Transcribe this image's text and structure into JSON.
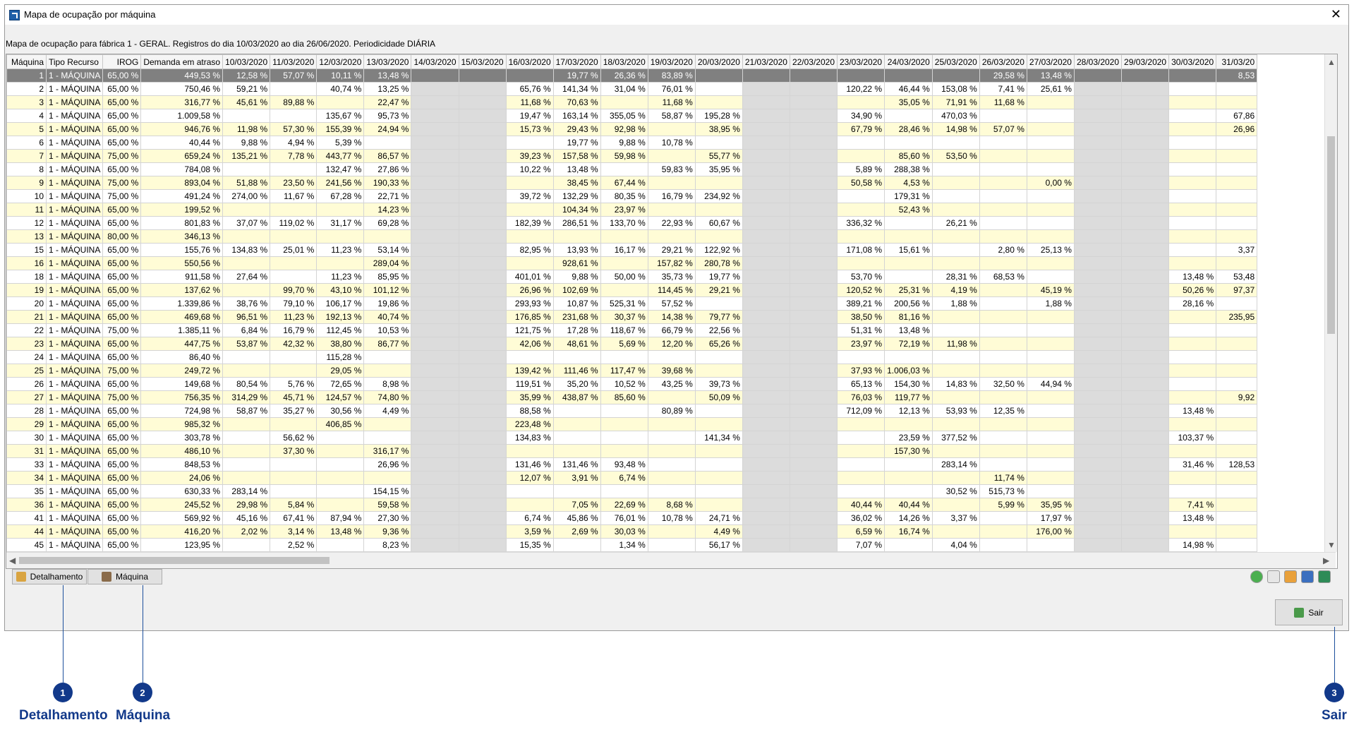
{
  "window": {
    "title": "Mapa de ocupação por máquina",
    "close": "✕"
  },
  "subtitle": "Mapa de ocupação para fábrica 1 - GERAL. Registros do dia 10/03/2020 ao dia 26/06/2020. Periodicidade DIÁRIA",
  "grid": {
    "columns": [
      "Máquina",
      "Tipo Recurso",
      "IROG",
      "Demanda em atraso",
      "10/03/2020",
      "11/03/2020",
      "12/03/2020",
      "13/03/2020",
      "14/03/2020",
      "15/03/2020",
      "16/03/2020",
      "17/03/2020",
      "18/03/2020",
      "19/03/2020",
      "20/03/2020",
      "21/03/2020",
      "22/03/2020",
      "23/03/2020",
      "24/03/2020",
      "25/03/2020",
      "26/03/2020",
      "27/03/2020",
      "28/03/2020",
      "29/03/2020",
      "30/03/2020",
      "31/03/20"
    ],
    "rows": [
      [
        "1",
        "1 - MÁQUINA",
        "65,00 %",
        "449,53 %",
        "12,58 %",
        "57,07 %",
        "10,11 %",
        "13,48 %",
        "",
        "",
        "",
        "19,77 %",
        "26,36 %",
        "83,89 %",
        "",
        "",
        "",
        "",
        "",
        "",
        "29,58 %",
        "13,48 %",
        "",
        "",
        "",
        "8,53"
      ],
      [
        "2",
        "1 - MÁQUINA",
        "65,00 %",
        "750,46 %",
        "59,21 %",
        "",
        "40,74 %",
        "13,25 %",
        "",
        "",
        "65,76 %",
        "141,34 %",
        "31,04 %",
        "76,01 %",
        "",
        "",
        "",
        "120,22 %",
        "46,44 %",
        "153,08 %",
        "7,41 %",
        "25,61 %",
        "",
        "",
        "",
        ""
      ],
      [
        "3",
        "1 - MÁQUINA",
        "65,00 %",
        "316,77 %",
        "45,61 %",
        "89,88 %",
        "",
        "22,47 %",
        "",
        "",
        "11,68 %",
        "70,63 %",
        "",
        "11,68 %",
        "",
        "",
        "",
        "",
        "35,05 %",
        "71,91 %",
        "11,68 %",
        "",
        "",
        "",
        "",
        ""
      ],
      [
        "4",
        "1 - MÁQUINA",
        "65,00 %",
        "1.009,58 %",
        "",
        "",
        "135,67 %",
        "95,73 %",
        "",
        "",
        "19,47 %",
        "163,14 %",
        "355,05 %",
        "58,87 %",
        "195,28 %",
        "",
        "",
        "34,90 %",
        "",
        "470,03 %",
        "",
        "",
        "",
        "",
        "",
        "67,86"
      ],
      [
        "5",
        "1 - MÁQUINA",
        "65,00 %",
        "946,76 %",
        "11,98 %",
        "57,30 %",
        "155,39 %",
        "24,94 %",
        "",
        "",
        "15,73 %",
        "29,43 %",
        "92,98 %",
        "",
        "38,95 %",
        "",
        "",
        "67,79 %",
        "28,46 %",
        "14,98 %",
        "57,07 %",
        "",
        "",
        "",
        "",
        "26,96"
      ],
      [
        "6",
        "1 - MÁQUINA",
        "65,00 %",
        "40,44 %",
        "9,88 %",
        "4,94 %",
        "5,39 %",
        "",
        "",
        "",
        "",
        "19,77 %",
        "9,88 %",
        "10,78 %",
        "",
        "",
        "",
        "",
        "",
        "",
        "",
        "",
        "",
        "",
        "",
        ""
      ],
      [
        "7",
        "1 - MÁQUINA",
        "75,00 %",
        "659,24 %",
        "135,21 %",
        "7,78 %",
        "443,77 %",
        "86,57 %",
        "",
        "",
        "39,23 %",
        "157,58 %",
        "59,98 %",
        "",
        "55,77 %",
        "",
        "",
        "",
        "85,60 %",
        "53,50 %",
        "",
        "",
        "",
        "",
        "",
        ""
      ],
      [
        "8",
        "1 - MÁQUINA",
        "65,00 %",
        "784,08 %",
        "",
        "",
        "132,47 %",
        "27,86 %",
        "",
        "",
        "10,22 %",
        "13,48 %",
        "",
        "59,83 %",
        "35,95 %",
        "",
        "",
        "5,89 %",
        "288,38 %",
        "",
        "",
        "",
        "",
        "",
        "",
        ""
      ],
      [
        "9",
        "1 - MÁQUINA",
        "75,00 %",
        "893,04 %",
        "51,88 %",
        "23,50 %",
        "241,56 %",
        "190,33 %",
        "",
        "",
        "",
        "38,45 %",
        "67,44 %",
        "",
        "",
        "",
        "",
        "50,58 %",
        "4,53 %",
        "",
        "",
        "0,00 %",
        "",
        "",
        "",
        ""
      ],
      [
        "10",
        "1 - MÁQUINA",
        "75,00 %",
        "491,24 %",
        "274,00 %",
        "11,67 %",
        "67,28 %",
        "22,71 %",
        "",
        "",
        "39,72 %",
        "132,29 %",
        "80,35 %",
        "16,79 %",
        "234,92 %",
        "",
        "",
        "",
        "179,31 %",
        "",
        "",
        "",
        "",
        "",
        "",
        ""
      ],
      [
        "11",
        "1 - MÁQUINA",
        "65,00 %",
        "199,52 %",
        "",
        "",
        "",
        "14,23 %",
        "",
        "",
        "",
        "104,34 %",
        "23,97 %",
        "",
        "",
        "",
        "",
        "",
        "52,43 %",
        "",
        "",
        "",
        "",
        "",
        "",
        ""
      ],
      [
        "12",
        "1 - MÁQUINA",
        "65,00 %",
        "801,83 %",
        "37,07 %",
        "119,02 %",
        "31,17 %",
        "69,28 %",
        "",
        "",
        "182,39 %",
        "286,51 %",
        "133,70 %",
        "22,93 %",
        "60,67 %",
        "",
        "",
        "336,32 %",
        "",
        "26,21 %",
        "",
        "",
        "",
        "",
        "",
        ""
      ],
      [
        "13",
        "1 - MÁQUINA",
        "80,00 %",
        "346,13 %",
        "",
        "",
        "",
        "",
        "",
        "",
        "",
        "",
        "",
        "",
        "",
        "",
        "",
        "",
        "",
        "",
        "",
        "",
        "",
        "",
        "",
        ""
      ],
      [
        "15",
        "1 - MÁQUINA",
        "65,00 %",
        "155,76 %",
        "134,83 %",
        "25,01 %",
        "11,23 %",
        "53,14 %",
        "",
        "",
        "82,95 %",
        "13,93 %",
        "16,17 %",
        "29,21 %",
        "122,92 %",
        "",
        "",
        "171,08 %",
        "15,61 %",
        "",
        "2,80 %",
        "25,13 %",
        "",
        "",
        "",
        "3,37"
      ],
      [
        "16",
        "1 - MÁQUINA",
        "65,00 %",
        "550,56 %",
        "",
        "",
        "",
        "289,04 %",
        "",
        "",
        "",
        "928,61 %",
        "",
        "157,82 %",
        "280,78 %",
        "",
        "",
        "",
        "",
        "",
        "",
        "",
        "",
        "",
        "",
        ""
      ],
      [
        "18",
        "1 - MÁQUINA",
        "65,00 %",
        "911,58 %",
        "27,64 %",
        "",
        "11,23 %",
        "85,95 %",
        "",
        "",
        "401,01 %",
        "9,88 %",
        "50,00 %",
        "35,73 %",
        "19,77 %",
        "",
        "",
        "53,70 %",
        "",
        "28,31 %",
        "68,53 %",
        "",
        "",
        "",
        "13,48 %",
        "53,48"
      ],
      [
        "19",
        "1 - MÁQUINA",
        "65,00 %",
        "137,62 %",
        "",
        "99,70 %",
        "43,10 %",
        "101,12 %",
        "",
        "",
        "26,96 %",
        "102,69 %",
        "",
        "114,45 %",
        "29,21 %",
        "",
        "",
        "120,52 %",
        "25,31 %",
        "4,19 %",
        "",
        "45,19 %",
        "",
        "",
        "50,26 %",
        "97,37"
      ],
      [
        "20",
        "1 - MÁQUINA",
        "65,00 %",
        "1.339,86 %",
        "38,76 %",
        "79,10 %",
        "106,17 %",
        "19,86 %",
        "",
        "",
        "293,93 %",
        "10,87 %",
        "525,31 %",
        "57,52 %",
        "",
        "",
        "",
        "389,21 %",
        "200,56 %",
        "1,88 %",
        "",
        "1,88 %",
        "",
        "",
        "28,16 %",
        ""
      ],
      [
        "21",
        "1 - MÁQUINA",
        "65,00 %",
        "469,68 %",
        "96,51 %",
        "11,23 %",
        "192,13 %",
        "40,74 %",
        "",
        "",
        "176,85 %",
        "231,68 %",
        "30,37 %",
        "14,38 %",
        "79,77 %",
        "",
        "",
        "38,50 %",
        "81,16 %",
        "",
        "",
        "",
        "",
        "",
        "",
        "235,95"
      ],
      [
        "22",
        "1 - MÁQUINA",
        "75,00 %",
        "1.385,11 %",
        "6,84 %",
        "16,79 %",
        "112,45 %",
        "10,53 %",
        "",
        "",
        "121,75 %",
        "17,28 %",
        "118,67 %",
        "66,79 %",
        "22,56 %",
        "",
        "",
        "51,31 %",
        "13,48 %",
        "",
        "",
        "",
        "",
        "",
        "",
        ""
      ],
      [
        "23",
        "1 - MÁQUINA",
        "65,00 %",
        "447,75 %",
        "53,87 %",
        "42,32 %",
        "38,80 %",
        "86,77 %",
        "",
        "",
        "42,06 %",
        "48,61 %",
        "5,69 %",
        "12,20 %",
        "65,26 %",
        "",
        "",
        "23,97 %",
        "72,19 %",
        "11,98 %",
        "",
        "",
        "",
        "",
        "",
        ""
      ],
      [
        "24",
        "1 - MÁQUINA",
        "65,00 %",
        "86,40 %",
        "",
        "",
        "115,28 %",
        "",
        "",
        "",
        "",
        "",
        "",
        "",
        "",
        "",
        "",
        "",
        "",
        "",
        "",
        "",
        "",
        "",
        "",
        ""
      ],
      [
        "25",
        "1 - MÁQUINA",
        "75,00 %",
        "249,72 %",
        "",
        "",
        "29,05 %",
        "",
        "",
        "",
        "139,42 %",
        "111,46 %",
        "117,47 %",
        "39,68 %",
        "",
        "",
        "",
        "37,93 %",
        "1.006,03 %",
        "",
        "",
        "",
        "",
        "",
        "",
        ""
      ],
      [
        "26",
        "1 - MÁQUINA",
        "65,00 %",
        "149,68 %",
        "80,54 %",
        "5,76 %",
        "72,65 %",
        "8,98 %",
        "",
        "",
        "119,51 %",
        "35,20 %",
        "10,52 %",
        "43,25 %",
        "39,73 %",
        "",
        "",
        "65,13 %",
        "154,30 %",
        "14,83 %",
        "32,50 %",
        "44,94 %",
        "",
        "",
        "",
        ""
      ],
      [
        "27",
        "1 - MÁQUINA",
        "75,00 %",
        "756,35 %",
        "314,29 %",
        "45,71 %",
        "124,57 %",
        "74,80 %",
        "",
        "",
        "35,99 %",
        "438,87 %",
        "85,60 %",
        "",
        "50,09 %",
        "",
        "",
        "76,03 %",
        "119,77 %",
        "",
        "",
        "",
        "",
        "",
        "",
        "9,92"
      ],
      [
        "28",
        "1 - MÁQUINA",
        "65,00 %",
        "724,98 %",
        "58,87 %",
        "35,27 %",
        "30,56 %",
        "4,49 %",
        "",
        "",
        "88,58 %",
        "",
        "",
        "80,89 %",
        "",
        "",
        "",
        "712,09 %",
        "12,13 %",
        "53,93 %",
        "12,35 %",
        "",
        "",
        "",
        "13,48 %",
        ""
      ],
      [
        "29",
        "1 - MÁQUINA",
        "65,00 %",
        "985,32 %",
        "",
        "",
        "406,85 %",
        "",
        "",
        "",
        "223,48 %",
        "",
        "",
        "",
        "",
        "",
        "",
        "",
        "",
        "",
        "",
        "",
        "",
        "",
        "",
        ""
      ],
      [
        "30",
        "1 - MÁQUINA",
        "65,00 %",
        "303,78 %",
        "",
        "56,62 %",
        "",
        "",
        "",
        "",
        "134,83 %",
        "",
        "",
        "",
        "141,34 %",
        "",
        "",
        "",
        "23,59 %",
        "377,52 %",
        "",
        "",
        "",
        "",
        "103,37 %",
        ""
      ],
      [
        "31",
        "1 - MÁQUINA",
        "65,00 %",
        "486,10 %",
        "",
        "37,30 %",
        "",
        "316,17 %",
        "",
        "",
        "",
        "",
        "",
        "",
        "",
        "",
        "",
        "",
        "157,30 %",
        "",
        "",
        "",
        "",
        "",
        "",
        ""
      ],
      [
        "33",
        "1 - MÁQUINA",
        "65,00 %",
        "848,53 %",
        "",
        "",
        "",
        "26,96 %",
        "",
        "",
        "131,46 %",
        "131,46 %",
        "93,48 %",
        "",
        "",
        "",
        "",
        "",
        "",
        "283,14 %",
        "",
        "",
        "",
        "",
        "31,46 %",
        "128,53"
      ],
      [
        "34",
        "1 - MÁQUINA",
        "65,00 %",
        "24,06 %",
        "",
        "",
        "",
        "",
        "",
        "",
        "12,07 %",
        "3,91 %",
        "6,74 %",
        "",
        "",
        "",
        "",
        "",
        "",
        "",
        "11,74 %",
        "",
        "",
        "",
        "",
        ""
      ],
      [
        "35",
        "1 - MÁQUINA",
        "65,00 %",
        "630,33 %",
        "283,14 %",
        "",
        "",
        "154,15 %",
        "",
        "",
        "",
        "",
        "",
        "",
        "",
        "",
        "",
        "",
        "",
        "30,52 %",
        "515,73 %",
        "",
        "",
        "",
        "",
        ""
      ],
      [
        "36",
        "1 - MÁQUINA",
        "65,00 %",
        "245,52 %",
        "29,98 %",
        "5,84 %",
        "",
        "59,58 %",
        "",
        "",
        "",
        "7,05 %",
        "22,69 %",
        "8,68 %",
        "",
        "",
        "",
        "40,44 %",
        "40,44 %",
        "",
        "5,99 %",
        "35,95 %",
        "",
        "",
        "7,41 %",
        ""
      ],
      [
        "41",
        "1 - MÁQUINA",
        "65,00 %",
        "569,92 %",
        "45,16 %",
        "67,41 %",
        "87,94 %",
        "27,30 %",
        "",
        "",
        "6,74 %",
        "45,86 %",
        "76,01 %",
        "10,78 %",
        "24,71 %",
        "",
        "",
        "36,02 %",
        "14,26 %",
        "3,37 %",
        "",
        "17,97 %",
        "",
        "",
        "13,48 %",
        ""
      ],
      [
        "44",
        "1 - MÁQUINA",
        "65,00 %",
        "416,20 %",
        "2,02 %",
        "3,14 %",
        "13,48 %",
        "9,36 %",
        "",
        "",
        "3,59 %",
        "2,69 %",
        "30,03 %",
        "",
        "4,49 %",
        "",
        "",
        "6,59 %",
        "16,74 %",
        "",
        "",
        "176,00 %",
        "",
        "",
        "",
        ""
      ],
      [
        "45",
        "1 - MÁQUINA",
        "65,00 %",
        "123,95 %",
        "",
        "2,52 %",
        "",
        "8,23 %",
        "",
        "",
        "15,35 %",
        "",
        "1,34 %",
        "",
        "56,17 %",
        "",
        "",
        "7,07 %",
        "",
        "4,04 %",
        "",
        "",
        "",
        "",
        "14,98 %",
        ""
      ]
    ]
  },
  "buttons": {
    "detalhamento": "Detalhamento",
    "maquina": "Máquina",
    "sair": "Sair"
  },
  "callouts": [
    {
      "num": "1",
      "label": "Detalhamento"
    },
    {
      "num": "2",
      "label": "Máquina"
    },
    {
      "num": "3",
      "label": "Sair"
    }
  ],
  "colors": {
    "row_even": "#fffcd6",
    "selected": "#808080",
    "weekend": "#dcdcdc",
    "callout": "#12398a"
  }
}
